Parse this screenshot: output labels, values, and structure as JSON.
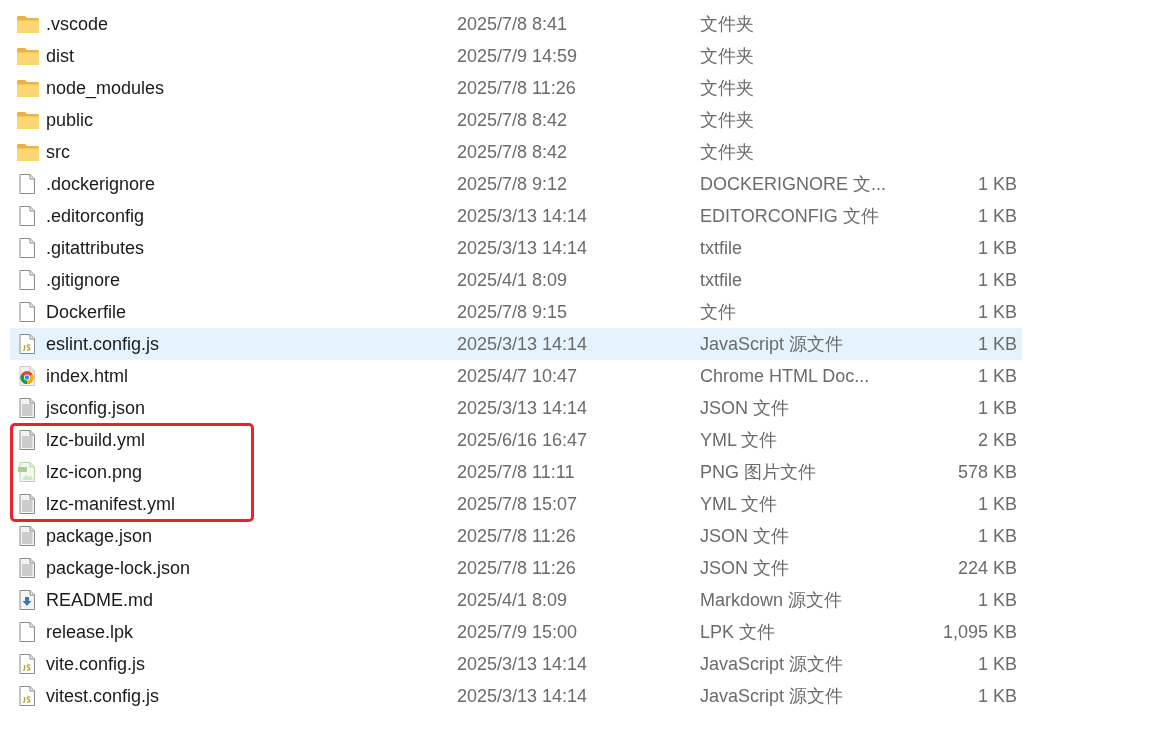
{
  "rows": [
    {
      "kind": "folder",
      "name": ".vscode",
      "modified": "2025/7/8 8:41",
      "type": "文件夹",
      "selected": false,
      "boxed": false
    },
    {
      "kind": "folder",
      "name": "dist",
      "modified": "2025/7/9 14:59",
      "type": "文件夹",
      "selected": false,
      "boxed": false
    },
    {
      "kind": "folder",
      "name": "node_modules",
      "modified": "2025/7/8 11:26",
      "type": "文件夹",
      "selected": false,
      "boxed": false
    },
    {
      "kind": "folder",
      "name": "public",
      "modified": "2025/7/8 8:42",
      "type": "文件夹",
      "selected": false,
      "boxed": false
    },
    {
      "kind": "folder",
      "name": "src",
      "modified": "2025/7/8 8:42",
      "type": "文件夹",
      "selected": false,
      "boxed": false
    },
    {
      "kind": "blank",
      "name": ".dockerignore",
      "modified": "2025/7/8 9:12",
      "type": "DOCKERIGNORE 文...",
      "size": "1 KB",
      "selected": false,
      "boxed": false
    },
    {
      "kind": "blank",
      "name": ".editorconfig",
      "modified": "2025/3/13 14:14",
      "type": "EDITORCONFIG 文件",
      "size": "1 KB",
      "selected": false,
      "boxed": false
    },
    {
      "kind": "blank",
      "name": ".gitattributes",
      "modified": "2025/3/13 14:14",
      "type": "txtfile",
      "size": "1 KB",
      "selected": false,
      "boxed": false
    },
    {
      "kind": "blank",
      "name": ".gitignore",
      "modified": "2025/4/1 8:09",
      "type": "txtfile",
      "size": "1 KB",
      "selected": false,
      "boxed": false
    },
    {
      "kind": "blank",
      "name": "Dockerfile",
      "modified": "2025/7/8 9:15",
      "type": "文件",
      "size": "1 KB",
      "selected": false,
      "boxed": false
    },
    {
      "kind": "script",
      "name": "eslint.config.js",
      "modified": "2025/3/13 14:14",
      "type": "JavaScript 源文件",
      "size": "1 KB",
      "selected": true,
      "boxed": false
    },
    {
      "kind": "browser",
      "name": "index.html",
      "modified": "2025/4/7 10:47",
      "type": "Chrome HTML Doc...",
      "size": "1 KB",
      "selected": false,
      "boxed": false
    },
    {
      "kind": "text",
      "name": "jsconfig.json",
      "modified": "2025/3/13 14:14",
      "type": "JSON 文件",
      "size": "1 KB",
      "selected": false,
      "boxed": false
    },
    {
      "kind": "text",
      "name": "lzc-build.yml",
      "modified": "2025/6/16 16:47",
      "type": "YML 文件",
      "size": "2 KB",
      "selected": false,
      "boxed": true
    },
    {
      "kind": "image",
      "name": "lzc-icon.png",
      "modified": "2025/7/8 11:11",
      "type": "PNG 图片文件",
      "size": "578 KB",
      "selected": false,
      "boxed": true
    },
    {
      "kind": "text",
      "name": "lzc-manifest.yml",
      "modified": "2025/7/8 15:07",
      "type": "YML 文件",
      "size": "1 KB",
      "selected": false,
      "boxed": true
    },
    {
      "kind": "text",
      "name": "package.json",
      "modified": "2025/7/8 11:26",
      "type": "JSON 文件",
      "size": "1 KB",
      "selected": false,
      "boxed": false
    },
    {
      "kind": "text",
      "name": "package-lock.json",
      "modified": "2025/7/8 11:26",
      "type": "JSON 文件",
      "size": "224 KB",
      "selected": false,
      "boxed": false
    },
    {
      "kind": "markdown",
      "name": "README.md",
      "modified": "2025/4/1 8:09",
      "type": "Markdown 源文件",
      "size": "1 KB",
      "selected": false,
      "boxed": false
    },
    {
      "kind": "blank",
      "name": "release.lpk",
      "modified": "2025/7/9 15:00",
      "type": "LPK 文件",
      "size": "1,095 KB",
      "selected": false,
      "boxed": false
    },
    {
      "kind": "script",
      "name": "vite.config.js",
      "modified": "2025/3/13 14:14",
      "type": "JavaScript 源文件",
      "size": "1 KB",
      "selected": false,
      "boxed": false
    },
    {
      "kind": "script",
      "name": "vitest.config.js",
      "modified": "2025/3/13 14:14",
      "type": "JavaScript 源文件",
      "size": "1 KB",
      "selected": false,
      "boxed": false
    }
  ]
}
